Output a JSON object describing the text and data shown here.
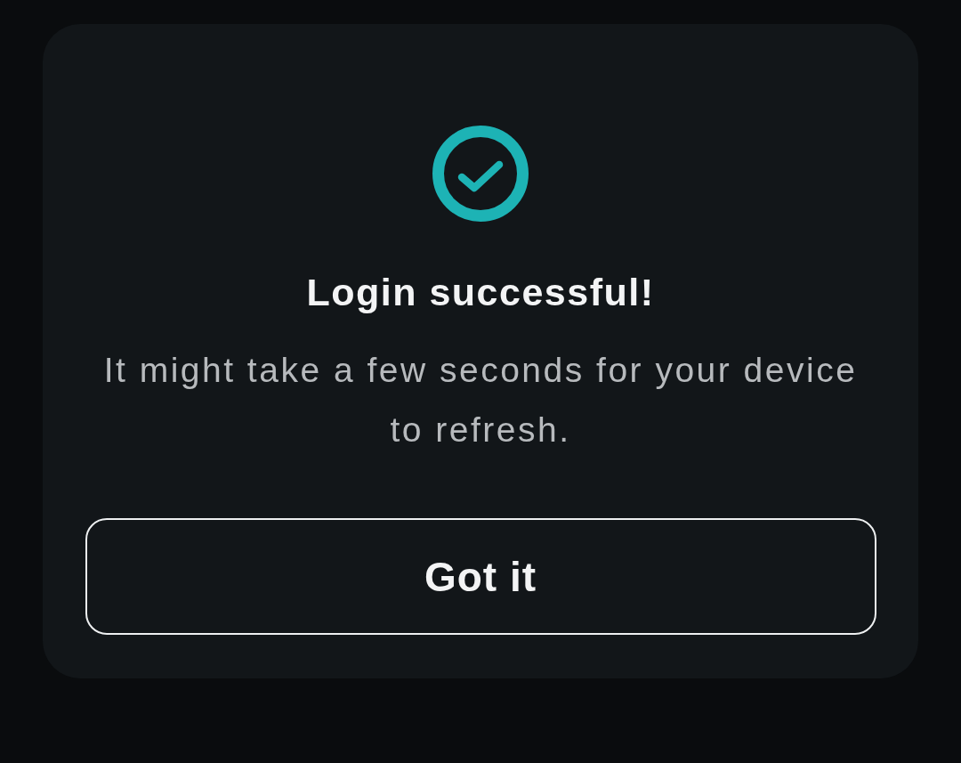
{
  "dialog": {
    "kind": "success",
    "title": "Login successful!",
    "message": "It might take a few seconds for your device to refresh.",
    "buttons": [
      "Got it"
    ]
  }
}
